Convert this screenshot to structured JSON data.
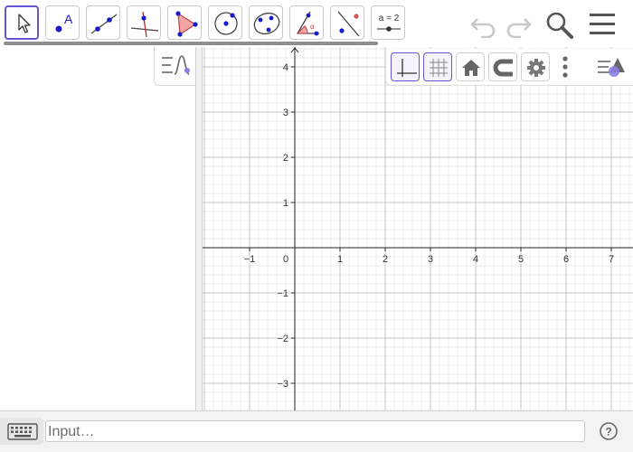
{
  "toolbar": {
    "tools": [
      {
        "name": "move-tool",
        "selected": true
      },
      {
        "name": "point-tool",
        "label": "A"
      },
      {
        "name": "line-tool"
      },
      {
        "name": "perpendicular-line-tool"
      },
      {
        "name": "polygon-tool"
      },
      {
        "name": "circle-with-center-tool"
      },
      {
        "name": "conic-through-points-tool"
      },
      {
        "name": "angle-tool"
      },
      {
        "name": "reflect-tool"
      },
      {
        "name": "slider-tool",
        "label": "a = 2"
      }
    ],
    "icons": [
      "undo-icon",
      "redo-icon",
      "search-icon",
      "menu-icon"
    ]
  },
  "algebra_view": {
    "toggle_icon": "algebra-view-toggle-icon"
  },
  "style_bar": {
    "buttons": [
      "show-axes-icon",
      "show-grid-icon",
      "standard-view-icon",
      "point-capturing-icon",
      "graphics-settings-icon",
      "more-options-icon",
      "toggle-style-bar-icon"
    ],
    "axes_active": true,
    "grid_active": true
  },
  "graphics_view": {
    "x_ticks": [
      "−1",
      "0",
      "1",
      "2",
      "3",
      "4",
      "5",
      "6",
      "7"
    ],
    "y_ticks_positive": [
      "1",
      "2",
      "3",
      "4"
    ],
    "y_ticks_negative": [
      "−1",
      "−2",
      "−3"
    ],
    "x_range": [
      -2,
      7.5
    ],
    "y_range": [
      -3.6,
      4.4
    ],
    "grid": "major-minor"
  },
  "input_bar": {
    "placeholder": "Input…",
    "keyboard_icon": "keyboard-icon",
    "help_icon": "help-icon"
  },
  "colors": {
    "accent": "#6557d2",
    "point_blue": "#1a1ac9",
    "polygon_fill": "#f4a6a6",
    "polygon_stroke": "#c04040"
  }
}
